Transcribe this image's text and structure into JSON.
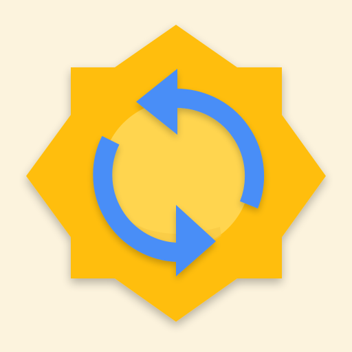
{
  "canvas": {
    "background_color": "#FCF3DD"
  },
  "icon": {
    "name": "sync-refresh-icon",
    "badge_shape": "eight-point-star",
    "colors": {
      "star": "#FFBE0D",
      "inner_circle": "#FFD54F",
      "arrows": "#4A8EF7",
      "shadow": "#B07A00"
    }
  }
}
